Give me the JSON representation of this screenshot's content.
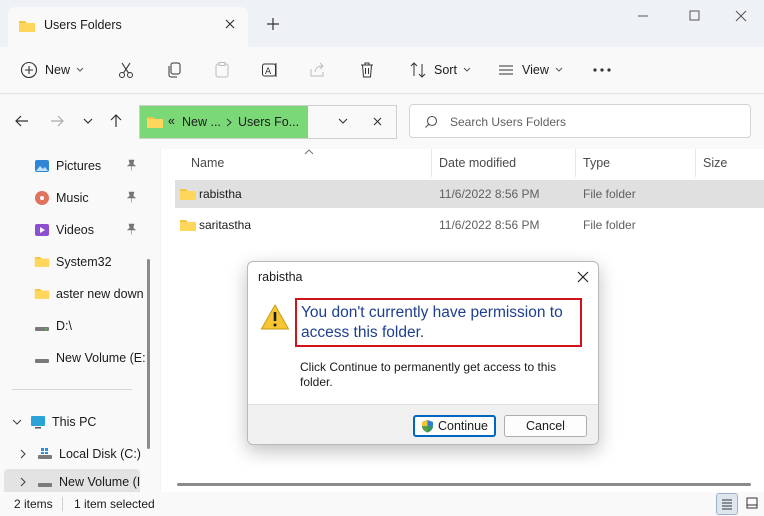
{
  "tab": {
    "title": "Users Folders"
  },
  "toolbar": {
    "new_label": "New",
    "sort_label": "Sort",
    "view_label": "View"
  },
  "address": {
    "crumb_overflow": "«",
    "crumb1": "New ...",
    "crumb2": "Users Fo..."
  },
  "search": {
    "placeholder": "Search Users Folders"
  },
  "sidebar": {
    "quick": [
      {
        "label": "Pictures",
        "icon": "pictures-icon"
      },
      {
        "label": "Music",
        "icon": "music-icon"
      },
      {
        "label": "Videos",
        "icon": "videos-icon"
      },
      {
        "label": "System32",
        "icon": "folder-icon"
      },
      {
        "label": "aster new down",
        "icon": "folder-icon"
      },
      {
        "label": "D:\\",
        "icon": "drive-icon"
      },
      {
        "label": "New Volume (E:",
        "icon": "drive-icon"
      }
    ],
    "this_pc": "This PC",
    "local_disk": "Local Disk (C:)",
    "new_volume": "New Volume (I"
  },
  "columns": {
    "name": "Name",
    "date": "Date modified",
    "type": "Type",
    "size": "Size"
  },
  "files": [
    {
      "name": "rabistha",
      "date": "11/6/2022 8:56 PM",
      "type": "File folder"
    },
    {
      "name": "saritastha",
      "date": "11/6/2022 8:56 PM",
      "type": "File folder"
    }
  ],
  "status": {
    "items": "2 items",
    "selected": "1 item selected"
  },
  "dialog": {
    "title": "rabistha",
    "heading": "You don't currently have permission to access this folder.",
    "body": "Click Continue to permanently get access to this folder.",
    "continue_label": "Continue",
    "cancel_label": "Cancel"
  },
  "colors": {
    "accent": "#0067c0",
    "address_highlight": "#7bd877",
    "warning_border": "#d0121b",
    "heading_text": "#1e3f8f"
  }
}
